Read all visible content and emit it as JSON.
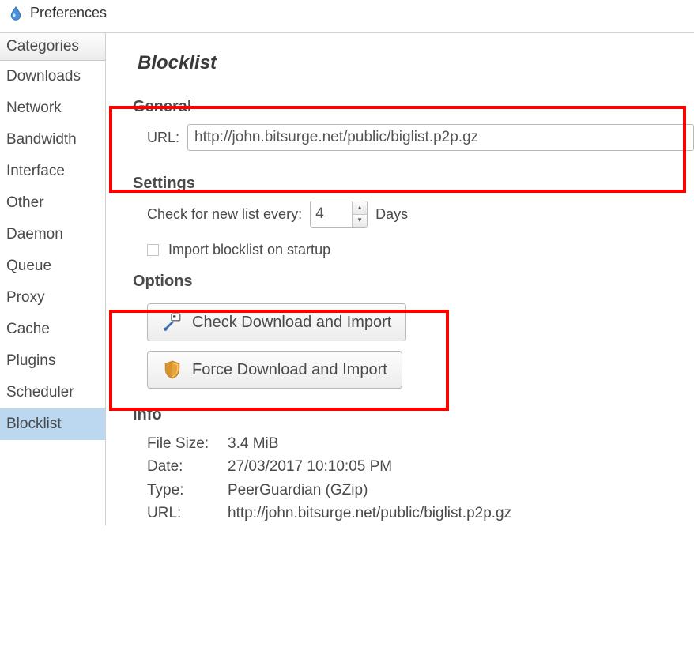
{
  "window": {
    "title": "Preferences"
  },
  "sidebar": {
    "header": "Categories",
    "items": [
      {
        "label": "Downloads"
      },
      {
        "label": "Network"
      },
      {
        "label": "Bandwidth"
      },
      {
        "label": "Interface"
      },
      {
        "label": "Other"
      },
      {
        "label": "Daemon"
      },
      {
        "label": "Queue"
      },
      {
        "label": "Proxy"
      },
      {
        "label": "Cache"
      },
      {
        "label": "Plugins"
      },
      {
        "label": "Scheduler"
      },
      {
        "label": "Blocklist"
      }
    ],
    "selected": "Blocklist"
  },
  "panel": {
    "title": "Blocklist",
    "general": {
      "heading": "General",
      "url_label": "URL:",
      "url_value": "http://john.bitsurge.net/public/biglist.p2p.gz"
    },
    "settings": {
      "heading": "Settings",
      "check_label": "Check for new list every:",
      "check_value": "4",
      "check_unit": "Days",
      "import_startup_label": "Import blocklist on startup",
      "import_startup_checked": false
    },
    "options": {
      "heading": "Options",
      "check_import_label": "Check Download and Import",
      "force_import_label": "Force Download and Import"
    },
    "info": {
      "heading": "Info",
      "rows": [
        {
          "label": "File Size:",
          "value": "3.4 MiB"
        },
        {
          "label": "Date:",
          "value": "27/03/2017 10:10:05 PM"
        },
        {
          "label": "Type:",
          "value": "PeerGuardian (GZip)"
        },
        {
          "label": "URL:",
          "value": "http://john.bitsurge.net/public/biglist.p2p.gz"
        }
      ]
    }
  }
}
